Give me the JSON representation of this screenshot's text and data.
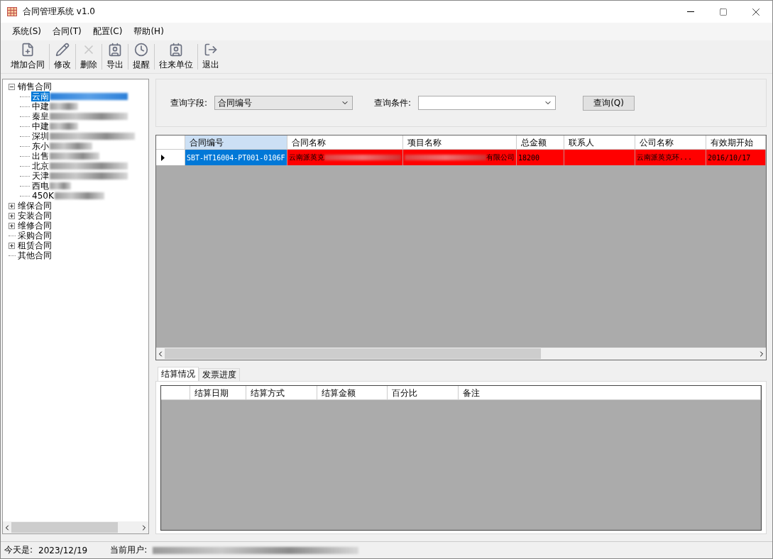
{
  "window": {
    "title": "合同管理系统 v1.0"
  },
  "menu": [
    "系统(S)",
    "合同(T)",
    "配置(C)",
    "帮助(H)"
  ],
  "toolbar": [
    {
      "label": "增加合同",
      "kind": "add",
      "disabled": false
    },
    {
      "label": "修改",
      "kind": "edit",
      "disabled": false
    },
    {
      "label": "删除",
      "kind": "delete",
      "disabled": true
    },
    {
      "label": "导出",
      "kind": "card",
      "disabled": false
    },
    {
      "label": "提醒",
      "kind": "clock",
      "disabled": false
    },
    {
      "label": "往来单位",
      "kind": "card",
      "disabled": false
    },
    {
      "label": "退出",
      "kind": "exit",
      "disabled": false
    }
  ],
  "tree": [
    {
      "label": "销售合同",
      "kind": "group",
      "expanded": true,
      "children": [
        {
          "label": "云南",
          "selected": true
        },
        {
          "label": "中建",
          "selected": false
        },
        {
          "label": "秦皇",
          "selected": false
        },
        {
          "label": "中建",
          "selected": false
        },
        {
          "label": "深圳",
          "selected": false
        },
        {
          "label": "东小",
          "selected": false
        },
        {
          "label": "出售",
          "selected": false
        },
        {
          "label": "北京",
          "selected": false
        },
        {
          "label": "天津",
          "selected": false
        },
        {
          "label": "西电",
          "selected": false
        },
        {
          "label": "450K",
          "selected": false
        }
      ]
    },
    {
      "label": "维保合同",
      "kind": "group",
      "expanded": false
    },
    {
      "label": "安装合同",
      "kind": "group",
      "expanded": false
    },
    {
      "label": "维修合同",
      "kind": "group",
      "expanded": false
    },
    {
      "label": "采购合同",
      "kind": "leaf"
    },
    {
      "label": "租赁合同",
      "kind": "group",
      "expanded": false
    },
    {
      "label": "其他合同",
      "kind": "leaf"
    }
  ],
  "query": {
    "field_label": "查询字段:",
    "field_value": "合同编号",
    "condition_label": "查询条件:",
    "button": "查询(Q)"
  },
  "table": {
    "columns": [
      "合同编号",
      "合同名称",
      "项目名称",
      "总金额",
      "联系人",
      "公司名称",
      "有效期开始"
    ],
    "rows": [
      {
        "color": "#ff0000",
        "current": true,
        "cells": [
          {
            "text": "SBT-HT16004-PT001-0106F",
            "kind": "plain",
            "selected": true
          },
          {
            "text": "云南派英克",
            "kind": "redacted_after",
            "selected": false
          },
          {
            "text": "有限公司",
            "kind": "redacted_before",
            "selected": false
          },
          {
            "text": "18200",
            "kind": "plain",
            "selected": false
          },
          {
            "text": "",
            "kind": "plain",
            "selected": false
          },
          {
            "text": "云南派英克环...",
            "kind": "plain",
            "selected": false
          },
          {
            "text": "2016/10/17",
            "kind": "plain",
            "selected": false
          }
        ]
      }
    ]
  },
  "tabs": [
    {
      "label": "结算情况",
      "selected": true
    },
    {
      "label": "发票进度",
      "selected": false
    }
  ],
  "sub_table": {
    "columns": [
      "结算日期",
      "结算方式",
      "结算金额",
      "百分比",
      "备注"
    ]
  },
  "status_bar": {
    "date_label": "今天是:",
    "date": "2023/12/19",
    "user_label": "当前用户:"
  }
}
